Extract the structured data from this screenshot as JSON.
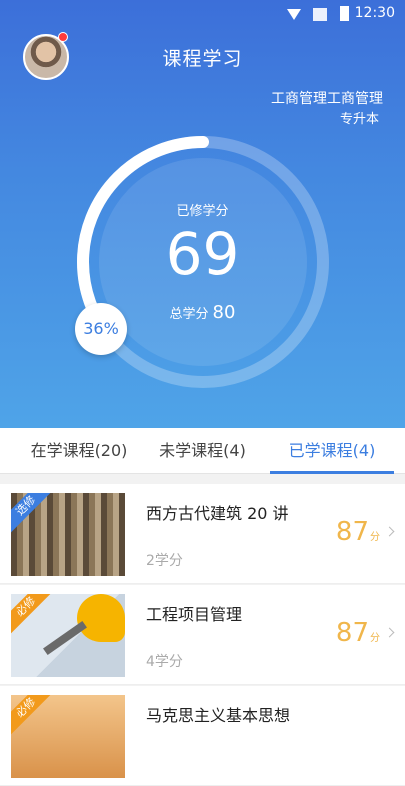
{
  "status_bar": {
    "time": "12:30"
  },
  "header": {
    "title": "课程学习",
    "major": "工商管理工商管理",
    "level": "专升本"
  },
  "progress": {
    "earned_label": "已修学分",
    "earned_value": "69",
    "total_label": "总学分",
    "total_value": "80",
    "percent_text": "36%",
    "percent": 36
  },
  "tabs": [
    {
      "label": "在学课程(20)"
    },
    {
      "label": "未学课程(4)"
    },
    {
      "label": "已学课程(4)"
    }
  ],
  "courses": [
    {
      "tag": "选修",
      "name": "西方古代建筑 20 讲",
      "credit": "2学分",
      "score": "87",
      "unit": "分"
    },
    {
      "tag": "必修",
      "name": "工程项目管理",
      "credit": "4学分",
      "score": "87",
      "unit": "分"
    },
    {
      "tag": "必修",
      "name": "马克思主义基本思想"
    }
  ],
  "colors": {
    "accent": "#3c7ee0",
    "score": "#f0b64b",
    "elective_tag": "#3c7ee0",
    "required_tag": "#f29a1b"
  }
}
